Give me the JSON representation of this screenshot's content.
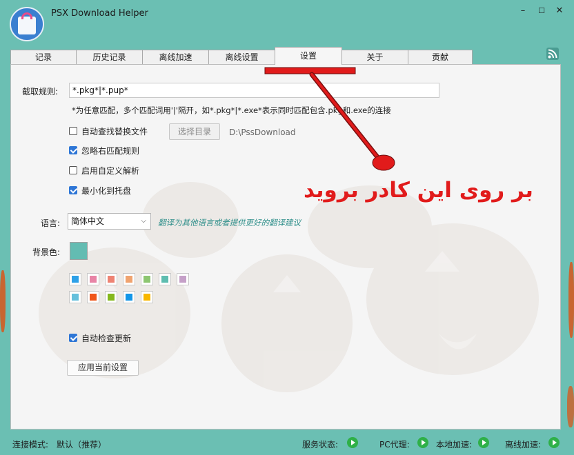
{
  "window": {
    "title": "PSX Download Helper",
    "controls": {
      "minimize": "–",
      "maximize": "☐",
      "close": "✕"
    }
  },
  "tabs": [
    {
      "label": "记录",
      "active": false
    },
    {
      "label": "历史记录",
      "active": false
    },
    {
      "label": "离线加速",
      "active": false
    },
    {
      "label": "离线设置",
      "active": false
    },
    {
      "label": "设置",
      "active": true
    },
    {
      "label": "关于",
      "active": false
    },
    {
      "label": "贡献",
      "active": false
    }
  ],
  "settings": {
    "rule_label": "截取规则:",
    "rule_value": "*.pkg*|*.pup*",
    "rule_hint": "*为任意匹配，多个匹配词用'|'隔开，如*.pkg*|*.exe*表示同时匹配包含.pkg和.exe的连接",
    "options": [
      {
        "label": "自动查找替换文件",
        "checked": false
      },
      {
        "label": "忽略右匹配规则",
        "checked": true
      },
      {
        "label": "启用自定义解析",
        "checked": false
      },
      {
        "label": "最小化到托盘",
        "checked": true
      }
    ],
    "select_dir_button": "选择目录",
    "download_path": "D:\\PssDownload",
    "language_label": "语言:",
    "language_value": "简体中文",
    "translate_link": "翻译为其他语言或者提供更好的翻译建议",
    "bg_label": "背景色:",
    "bg_color": "#63bcb2",
    "palette_row1": [
      "#2ea1e8",
      "#e884a6",
      "#ee8373",
      "#f0a36f",
      "#8dc671",
      "#5ebdb0",
      "#c5a0c8"
    ],
    "palette_row2": [
      "#66c0dc",
      "#f0561a",
      "#85b81d",
      "#1296e8",
      "#f8b700"
    ],
    "auto_update_label": "自动检查更新",
    "auto_update_checked": true,
    "apply_button": "应用当前设置"
  },
  "annotation": {
    "text": "بر روی این کادر بروید",
    "color": "#e11b1b"
  },
  "status": {
    "mode_label": "连接模式:",
    "mode_value": "默认（推荐）",
    "service_label": "服务状态:",
    "proxy_label": "PC代理:",
    "local_label": "本地加速:",
    "offline_label": "离线加速:"
  }
}
